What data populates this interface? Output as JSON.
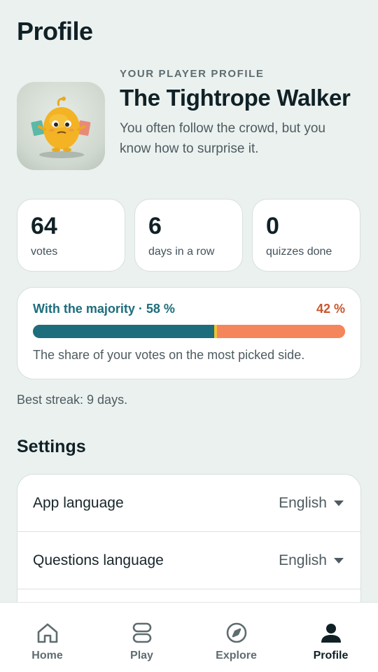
{
  "page": {
    "title": "Profile"
  },
  "profile": {
    "eyebrow": "YOUR PLAYER PROFILE",
    "name": "The Tightrope Walker",
    "description": "You often follow the crowd, but you know how to surprise it."
  },
  "stats": [
    {
      "value": "64",
      "label": "votes"
    },
    {
      "value": "6",
      "label": "days in a row"
    },
    {
      "value": "0",
      "label": "quizzes done"
    }
  ],
  "majority": {
    "label": "With the majority · 58 %",
    "minority_label": "42 %",
    "majority_share": 58,
    "minority_share": 42,
    "caption": "The share of your votes on the most picked side.",
    "colors": {
      "majority": "#1d6d7c",
      "minority": "#f5855a",
      "divider": "#f2c230"
    }
  },
  "best_streak": "Best streak: 9 days.",
  "settings": {
    "title": "Settings",
    "rows": [
      {
        "label": "App language",
        "value": "English"
      },
      {
        "label": "Questions language",
        "value": "English"
      }
    ]
  },
  "nav": {
    "items": [
      {
        "label": "Home",
        "icon": "home-icon"
      },
      {
        "label": "Play",
        "icon": "play-icon"
      },
      {
        "label": "Explore",
        "icon": "compass-icon"
      },
      {
        "label": "Profile",
        "icon": "person-icon"
      }
    ],
    "active": "Profile"
  }
}
